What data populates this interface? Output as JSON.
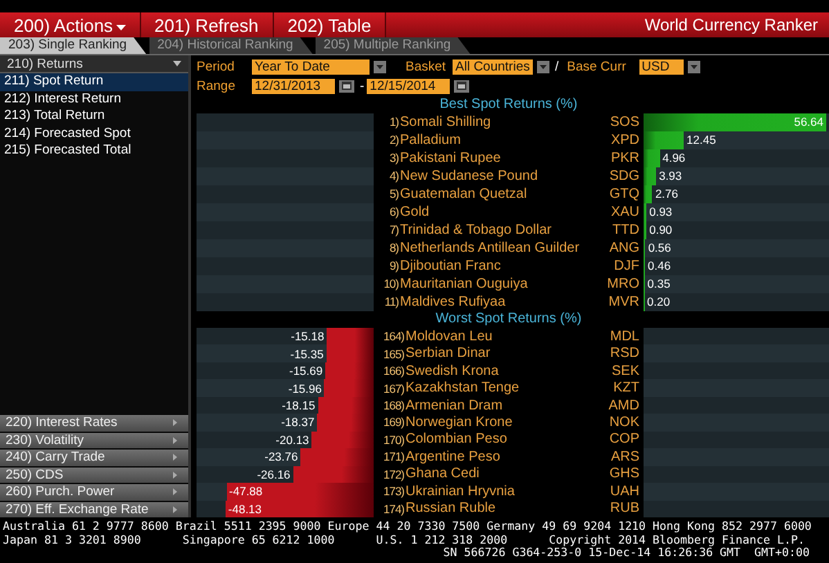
{
  "menu_bar": {
    "buttons": [
      {
        "label": "200) Actions",
        "has_menu": true
      },
      {
        "label": "201) Refresh",
        "has_menu": false
      },
      {
        "label": "202) Table",
        "has_menu": false
      }
    ],
    "title": "World Currency Ranker"
  },
  "tabs": [
    {
      "label": "203) Single Ranking",
      "selected": true
    },
    {
      "label": "204) Historical Ranking",
      "selected": false
    },
    {
      "label": "205) Multiple Ranking",
      "selected": false
    }
  ],
  "sidebar": {
    "header": "210) Returns",
    "items": [
      {
        "label": "211) Spot Return",
        "selected": true
      },
      {
        "label": "212) Interest Return",
        "selected": false
      },
      {
        "label": "213) Total Return",
        "selected": false
      },
      {
        "label": "214) Forecasted Spot",
        "selected": false
      },
      {
        "label": "215) Forecasted Total",
        "selected": false
      }
    ],
    "groups": [
      "220) Interest Rates",
      "230) Volatility",
      "240) Carry Trade",
      "250) CDS",
      "260) Purch. Power",
      "270) Eff. Exchange Rate"
    ]
  },
  "controls": {
    "period": {
      "label": "Period",
      "value": "Year To Date"
    },
    "basket": {
      "label": "Basket",
      "value": "All Countries"
    },
    "separator": "/",
    "base_curr": {
      "label": "Base Curr",
      "value": "USD"
    },
    "range": {
      "label": "Range",
      "from": "12/31/2013",
      "dash": "-",
      "to": "12/15/2014"
    }
  },
  "best": {
    "title": "Best Spot Returns (%)",
    "rows": [
      {
        "rank": "1)",
        "name": "Somali Shilling",
        "code": "SOS",
        "value": "56.64",
        "level": 1
      },
      {
        "rank": "2)",
        "name": "Palladium",
        "code": "XPD",
        "value": "12.45",
        "level": 0.22
      },
      {
        "rank": "3)",
        "name": "Pakistani Rupee",
        "code": "PKR",
        "value": "4.96",
        "level": 0.088
      },
      {
        "rank": "4)",
        "name": "New Sudanese Pound",
        "code": "SDG",
        "value": "3.93",
        "level": 0.069
      },
      {
        "rank": "5)",
        "name": "Guatemalan Quetzal",
        "code": "GTQ",
        "value": "2.76",
        "level": 0.049
      },
      {
        "rank": "6)",
        "name": "Gold",
        "code": "XAU",
        "value": "0.93",
        "level": 0.016
      },
      {
        "rank": "7)",
        "name": "Trinidad & Tobago Dollar",
        "code": "TTD",
        "value": "0.90",
        "level": 0.016
      },
      {
        "rank": "8)",
        "name": "Netherlands Antillean Guilder",
        "code": "ANG",
        "value": "0.56",
        "level": 0.01
      },
      {
        "rank": "9)",
        "name": "Djiboutian Franc",
        "code": "DJF",
        "value": "0.46",
        "level": 0.008
      },
      {
        "rank": "10)",
        "name": "Mauritanian Ouguiya",
        "code": "MRO",
        "value": "0.35",
        "level": 0.006
      },
      {
        "rank": "11)",
        "name": "Maldives Rufiyaa",
        "code": "MVR",
        "value": "0.20",
        "level": 0.004
      }
    ]
  },
  "worst": {
    "title": "Worst Spot Returns (%)",
    "rows": [
      {
        "rank": "164)",
        "name": "Moldovan Leu",
        "code": "MDL",
        "value": "-15.18",
        "level": 0.268
      },
      {
        "rank": "165)",
        "name": "Serbian Dinar",
        "code": "RSD",
        "value": "-15.35",
        "level": 0.271
      },
      {
        "rank": "166)",
        "name": "Swedish Krona",
        "code": "SEK",
        "value": "-15.69",
        "level": 0.277
      },
      {
        "rank": "167)",
        "name": "Kazakhstan Tenge",
        "code": "KZT",
        "value": "-15.96",
        "level": 0.282
      },
      {
        "rank": "168)",
        "name": "Armenian Dram",
        "code": "AMD",
        "value": "-18.15",
        "level": 0.32
      },
      {
        "rank": "169)",
        "name": "Norwegian Krone",
        "code": "NOK",
        "value": "-18.37",
        "level": 0.324
      },
      {
        "rank": "170)",
        "name": "Colombian Peso",
        "code": "COP",
        "value": "-20.13",
        "level": 0.355
      },
      {
        "rank": "171)",
        "name": "Argentine Peso",
        "code": "ARS",
        "value": "-23.76",
        "level": 0.419
      },
      {
        "rank": "172)",
        "name": "Ghana Cedi",
        "code": "GHS",
        "value": "-26.16",
        "level": 0.462
      },
      {
        "rank": "173)",
        "name": "Ukrainian Hryvnia",
        "code": "UAH",
        "value": "-47.88",
        "level": 0.845
      },
      {
        "rank": "174)",
        "name": "Russian Ruble",
        "code": "RUB",
        "value": "-48.13",
        "level": 0.85
      }
    ]
  },
  "footer": {
    "lines": [
      "Australia 61 2 9777 8600 Brazil 5511 2395 9000 Europe 44 20 7330 7500 Germany 49 69 9204 1210 Hong Kong 852 2977 6000",
      "Japan 81 3 3201 8900      Singapore 65 6212 1000      U.S. 1 212 318 2000      Copyright 2014 Bloomberg Finance L.P.",
      "SN 566726 G364-253-0 15-Dec-14 16:26:36 GMT  GMT+0:00"
    ]
  }
}
